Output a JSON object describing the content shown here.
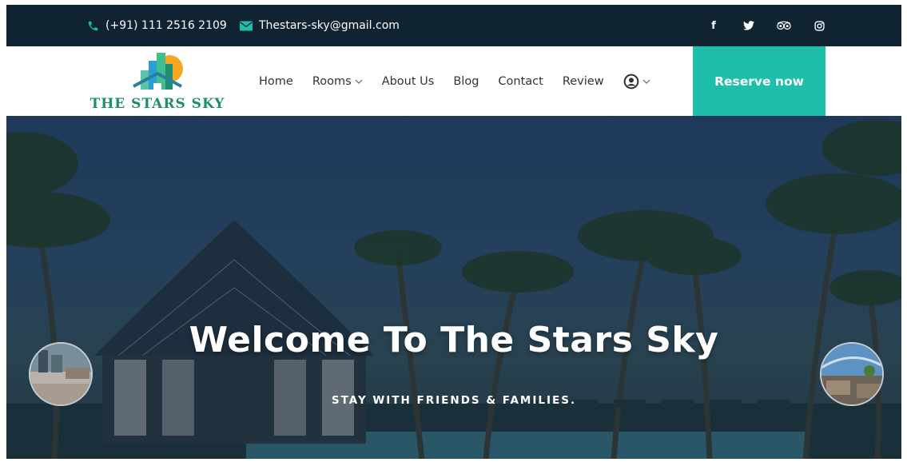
{
  "topbar": {
    "phone": "(+91) 111 2516 2109",
    "email": "Thestars-sky@gmail.com",
    "social": [
      {
        "icon": "facebook-icon",
        "glyph": "f"
      },
      {
        "icon": "twitter-icon",
        "glyph": ""
      },
      {
        "icon": "tripadvisor-icon",
        "glyph": ""
      },
      {
        "icon": "instagram-icon",
        "glyph": ""
      }
    ]
  },
  "brand": {
    "name": "THE STARS SKY",
    "color": "#1e8e6e"
  },
  "nav": {
    "items": [
      {
        "label": "Home",
        "has_dropdown": false
      },
      {
        "label": "Rooms",
        "has_dropdown": true
      },
      {
        "label": "About Us",
        "has_dropdown": false
      },
      {
        "label": "Blog",
        "has_dropdown": false
      },
      {
        "label": "Contact",
        "has_dropdown": false
      },
      {
        "label": "Review",
        "has_dropdown": false
      }
    ],
    "user_menu_icon": "user-circle-icon",
    "cta_label": "Reserve now"
  },
  "hero": {
    "title": "Welcome To The Stars Sky",
    "subtitle": "STAY WITH FRIENDS & FAMILIES."
  },
  "colors": {
    "topbar_bg": "#0f2430",
    "accent": "#1dbfaa",
    "brand": "#1e8e6e"
  }
}
